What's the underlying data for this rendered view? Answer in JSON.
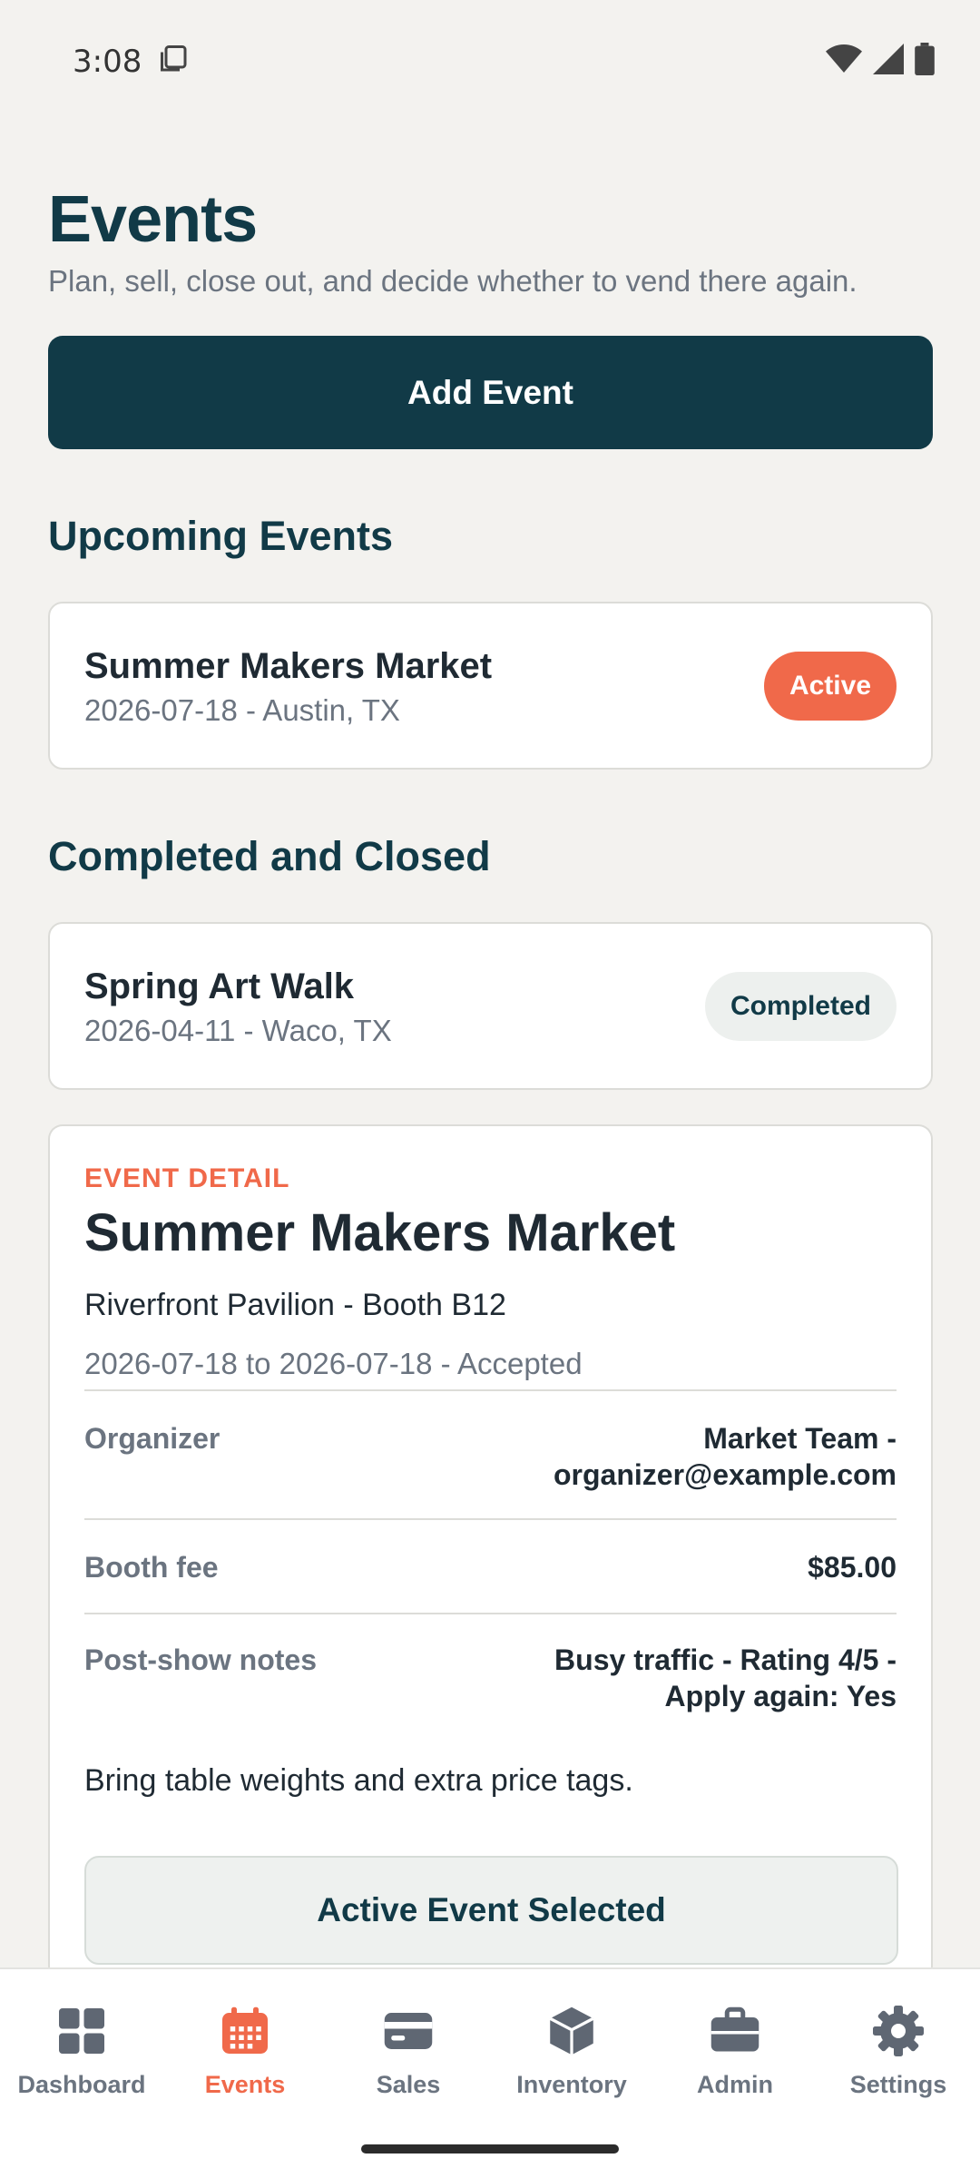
{
  "status_bar": {
    "time": "3:08"
  },
  "header": {
    "title": "Events",
    "subtitle": "Plan, sell, close out, and decide whether to vend there again."
  },
  "add_event_label": "Add Event",
  "upcoming": {
    "title": "Upcoming Events",
    "events": [
      {
        "name": "Summer Makers Market",
        "meta": "2026-07-18 - Austin, TX",
        "status": "Active"
      }
    ]
  },
  "completed": {
    "title": "Completed and Closed",
    "events": [
      {
        "name": "Spring Art Walk",
        "meta": "2026-04-11 - Waco, TX",
        "status": "Completed"
      }
    ]
  },
  "detail": {
    "eyebrow": "EVENT DETAIL",
    "title": "Summer Makers Market",
    "venue": "Riverfront Pavilion - Booth B12",
    "dates": "2026-07-18 to 2026-07-18 - Accepted",
    "organizer_label": "Organizer",
    "organizer_value_line1": "Market Team -",
    "organizer_value_line2": "organizer@example.com",
    "fee_label": "Booth fee",
    "fee_value": "$85.00",
    "notes_label": "Post-show notes",
    "notes_value_line1": "Busy traffic - Rating 4/5 -",
    "notes_value_line2": "Apply again: Yes",
    "note": "Bring table weights and extra price tags.",
    "selected_label": "Active Event Selected"
  },
  "nav": {
    "items": [
      {
        "label": "Dashboard",
        "icon": "grid-icon"
      },
      {
        "label": "Events",
        "icon": "calendar-icon"
      },
      {
        "label": "Sales",
        "icon": "card-icon"
      },
      {
        "label": "Inventory",
        "icon": "box-icon"
      },
      {
        "label": "Admin",
        "icon": "briefcase-icon"
      },
      {
        "label": "Settings",
        "icon": "gear-icon"
      }
    ],
    "active_index": 1
  },
  "colors": {
    "primary": "#113a47",
    "accent": "#f0694a",
    "background": "#f3f2ef",
    "muted": "#6b7480"
  }
}
